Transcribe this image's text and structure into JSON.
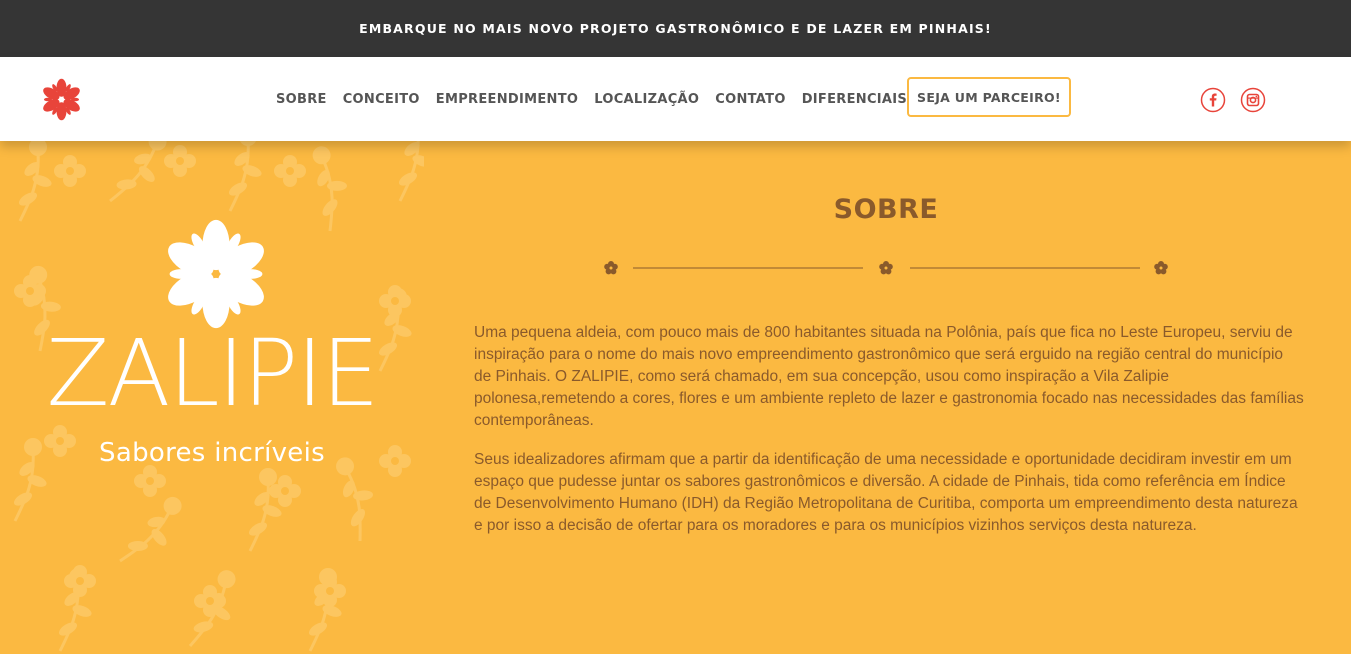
{
  "announcement": "EMBARQUE NO MAIS NOVO PROJETO GASTRONÔMICO E DE LAZER EM PINHAIS!",
  "nav": {
    "links": [
      "SOBRE",
      "CONCEITO",
      "EMPREENDIMENTO",
      "LOCALIZAÇÃO",
      "CONTATO",
      "DIFERENCIAIS"
    ],
    "partner_button": "SEJA UM PARCEIRO!",
    "social": [
      "facebook-icon",
      "instagram-icon"
    ]
  },
  "brand": {
    "name": "ZALIPIE",
    "tagline": "Sabores incríveis"
  },
  "about": {
    "title": "SOBRE",
    "paragraphs": [
      "Uma pequena aldeia, com pouco mais de 800 habitantes situada na Polônia, país que fica no Leste Europeu, serviu de inspiração para o nome do mais novo empreendimento gastronômico que será erguido na região central do município de Pinhais. O ZALIPIE, como será chamado, em sua concepção, usou como inspiração a Vila Zalipie polonesa,remetendo a cores, flores e um ambiente repleto de lazer e gastronomia focado nas necessidades das famílias contemporâneas.",
      "Seus idealizadores afirmam que a partir da identificação de uma necessidade e oportunidade decidiram investir em um espaço que pudesse juntar os sabores gastronômicos e diversão. A cidade de Pinhais, tida como referência em Índice de Desenvolvimento Humano (IDH) da Região Metropolitana de Curitiba, comporta um empreendimento desta natureza e por isso a decisão de ofertar para os moradores e para os municípios vizinhos serviços desta natureza."
    ]
  },
  "colors": {
    "topbar": "#353535",
    "accent": "#fbb941",
    "text_brown": "#8a5a2b",
    "logo_red": "#e8443a"
  }
}
